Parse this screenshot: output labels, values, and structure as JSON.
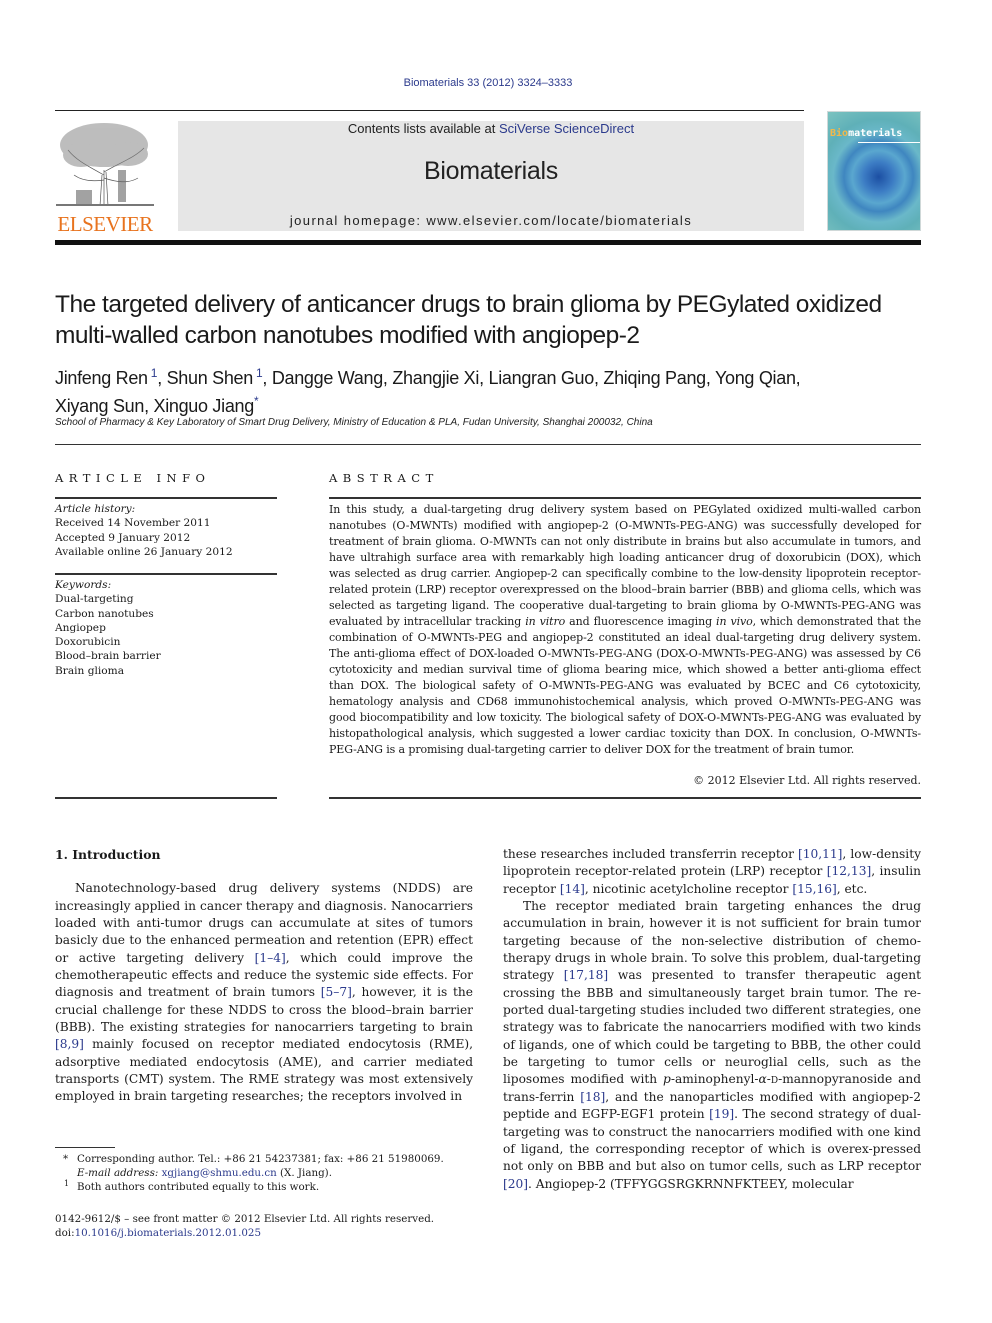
{
  "header": {
    "citation": "Biomaterials 33 (2012) 3324–3333",
    "contents_prefix": "Contents lists available at ",
    "contents_link": "SciVerse ScienceDirect",
    "journal_title": "Biomaterials",
    "homepage": "journal homepage: www.elsevier.com/locate/biomaterials",
    "publisher_wordmark": "ELSEVIER",
    "cover_title_highlight": "Bio",
    "cover_title_rest": "materials"
  },
  "article": {
    "title": "The targeted delivery of anticancer drugs to brain glioma by PEGylated oxidized multi-walled carbon nanotubes modified with angiopep-2",
    "authors": [
      {
        "name": "Jinfeng Ren",
        "mark": "1"
      },
      {
        "name": "Shun Shen",
        "mark": "1"
      },
      {
        "name": "Dangge Wang",
        "mark": ""
      },
      {
        "name": "Zhangjie Xi",
        "mark": ""
      },
      {
        "name": "Liangran Guo",
        "mark": ""
      },
      {
        "name": "Zhiqing Pang",
        "mark": ""
      },
      {
        "name": "Yong Qian",
        "mark": ""
      },
      {
        "name": "Xiyang Sun",
        "mark": ""
      },
      {
        "name": "Xinguo Jiang",
        "mark": "*"
      }
    ],
    "affiliation": "School of Pharmacy & Key Laboratory of Smart Drug Delivery, Ministry of Education & PLA, Fudan University, Shanghai 200032, China"
  },
  "article_info": {
    "heading": "ARTICLE INFO",
    "history_label": "Article history:",
    "history": [
      "Received 14 November 2011",
      "Accepted 9 January 2012",
      "Available online 26 January 2012"
    ],
    "keywords_label": "Keywords:",
    "keywords": [
      "Dual-targeting",
      "Carbon nanotubes",
      "Angiopep",
      "Doxorubicin",
      "Blood–brain barrier",
      "Brain glioma"
    ]
  },
  "abstract": {
    "heading": "ABSTRACT",
    "text_1": "In this study, a dual-targeting drug delivery system based on PEGylated oxidized multi-walled carbon nanotubes (O-MWNTs) modified with angiopep-2 (O-MWNTs-PEG-ANG) was successfully developed for treatment of brain glioma. O-MWNTs can not only distribute in brains but also accumulate in tumors, and have ultrahigh surface area with remarkably high loading anticancer drug of doxorubicin (DOX), which was selected as drug carrier. Angiopep-2 can specifically combine to the low-density lipoprotein receptor-related protein (LRP) receptor overexpressed on the blood–brain barrier (BBB) and glioma cells, which was selected as targeting ligand. The cooperative dual-targeting to brain glioma by O-MWNTs-PEG-ANG was evaluated by intracellular tracking ",
    "italic_1": "in vitro",
    "text_2": " and fluorescence imaging ",
    "italic_2": "in vivo",
    "text_3": ", which demonstrated that the combination of O-MWNTs-PEG and angiopep-2 constituted an ideal dual-targeting drug delivery system. The anti-glioma effect of DOX-loaded O-MWNTs-PEG-ANG (DOX-O-MWNTs-PEG-ANG) was assessed by C6 cytotoxicity and median survival time of glioma bearing mice, which showed a better anti-glioma effect than DOX. The biological safety of O-MWNTs-PEG-ANG was evaluated by BCEC and C6 cytotoxicity, hematology analysis and CD68 immunohistochemical analysis, which proved O-MWNTs-PEG-ANG was good biocompatibility and low toxicity. The biological safety of DOX-O-MWNTs-PEG-ANG was evaluated by histopathological analysis, which suggested a lower cardiac toxicity than DOX. In conclusion, O-MWNTs-PEG-ANG is a promising dual-targeting carrier to deliver DOX for the treatment of brain tumor.",
    "copyright": "© 2012 Elsevier Ltd. All rights reserved."
  },
  "introduction": {
    "heading": "1.  Introduction",
    "left_p1": [
      {
        "t": "Nanotechnology-based drug delivery systems (NDDS) are increasingly applied in cancer therapy and diagnosis. Nanocarriers loaded with anti-tumor drugs can accumulate at sites of tumors basicly due to the enhanced permeation and retention (EPR) effect or active targeting delivery "
      },
      {
        "ref": "[1–4]"
      },
      {
        "t": ", which could improve the chemotherapeutic effects and reduce the systemic side effects. For diagnosis and treatment of brain tumors "
      },
      {
        "ref": "[5–7]"
      },
      {
        "t": ", however, it is the crucial challenge for these NDDS to cross the blood–brain barrier (BBB). The existing strategies for nanocarriers targeting to brain "
      },
      {
        "ref": "[8,9]"
      },
      {
        "t": " mainly focused on receptor mediated endocytosis (RME), adsorptive mediated endocytosis (AME), and carrier mediated transports (CMT) system. The RME strategy was most extensively employed in brain targeting researches; the receptors involved in"
      }
    ],
    "right_p1": [
      {
        "t": "these researches included transferrin receptor "
      },
      {
        "ref": "[10,11]"
      },
      {
        "t": ", low-density lipoprotein receptor-related protein (LRP) receptor "
      },
      {
        "ref": "[12,13]"
      },
      {
        "t": ", insulin receptor "
      },
      {
        "ref": "[14]"
      },
      {
        "t": ", nicotinic acetylcholine receptor "
      },
      {
        "ref": "[15,16]"
      },
      {
        "t": ", etc."
      }
    ],
    "right_p2": [
      {
        "t": "The receptor mediated brain targeting enhances the drug accumulation in brain, however it is not sufficient for brain tumor targeting because of the non-selective distribution of chemo-therapy drugs in whole brain. To solve this problem, dual-targeting strategy "
      },
      {
        "ref": "[17,18]"
      },
      {
        "t": " was presented to transfer therapeutic agent crossing the BBB and simultaneously target brain tumor. The re-ported dual-targeting studies included two different strategies, one strategy was to fabricate the nanocarriers modified with two kinds of ligands, one of which could be targeting to BBB, the other could be targeting to tumor cells or neuroglial cells, such as the liposomes modified with "
      },
      {
        "i": "p"
      },
      {
        "t": "-aminophenyl-"
      },
      {
        "i": "α"
      },
      {
        "t": "-"
      },
      {
        "sc": "d"
      },
      {
        "t": "-mannopyranoside and trans-ferrin "
      },
      {
        "ref": "[18]"
      },
      {
        "t": ", and the nanoparticles modified with angiopep-2 peptide and EGFP-EGF1 protein "
      },
      {
        "ref": "[19]"
      },
      {
        "t": ". The second strategy of dual-targeting was to construct the nanocarriers modified with one kind of ligand, the corresponding receptor of which is overex-pressed not only on BBB and but also on tumor cells, such as LRP receptor "
      },
      {
        "ref": "[20]"
      },
      {
        "t": ". Angiopep-2 (TFFYGGSRGKRNNFKTEEY, molecular"
      }
    ]
  },
  "footnotes": {
    "star_mark": "*",
    "corresponding": "Corresponding author. Tel.: +86 21 54237381; fax: +86 21 51980069.",
    "email_label": "E-mail address:",
    "email": "xgjiang@shmu.edu.cn",
    "email_suffix": " (X. Jiang).",
    "one_mark": "1",
    "equal": "Both authors contributed equally to this work."
  },
  "front_matter": {
    "issn_line": "0142-9612/$ – see front matter © 2012 Elsevier Ltd. All rights reserved.",
    "doi_prefix": "doi:",
    "doi": "10.1016/j.biomaterials.2012.01.025"
  },
  "colors": {
    "link": "#2b3a8c",
    "elsevier_orange": "#e8731e",
    "header_box": "#e6e6e6"
  }
}
